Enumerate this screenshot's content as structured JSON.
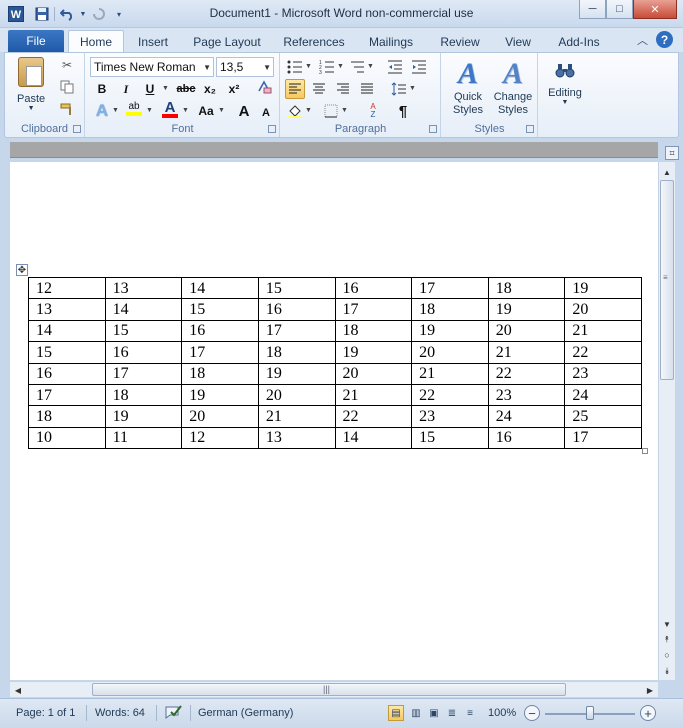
{
  "window": {
    "title": "Document1  -  Microsoft Word non-commercial use",
    "app_icon_letter": "W",
    "minimize": "─",
    "maximize": "□",
    "close": "✕"
  },
  "tabs": {
    "file": "File",
    "items": [
      "Home",
      "Insert",
      "Page Layout",
      "References",
      "Mailings",
      "Review",
      "View",
      "Add-Ins"
    ],
    "active": "Home"
  },
  "ribbon": {
    "clipboard": {
      "label": "Clipboard",
      "paste": "Paste"
    },
    "font": {
      "label": "Font",
      "font_name": "Times New Roman",
      "font_size": "13,5",
      "bold": "B",
      "italic": "I",
      "underline": "U",
      "strike": "abc",
      "subscript": "x₂",
      "superscript": "x²",
      "grow": "A",
      "shrink": "A",
      "case": "Aa",
      "color_a": "A",
      "highlight": "ab"
    },
    "paragraph": {
      "label": "Paragraph",
      "pilcrow": "¶"
    },
    "styles": {
      "label": "Styles",
      "quick_styles": "Quick Styles",
      "change_styles": "Change Styles",
      "glyph": "A"
    },
    "editing": {
      "label": "Editing"
    }
  },
  "accent_colors": {
    "file_tab": "#2b64b4",
    "highlight_yellow": "#ffff00",
    "font_red": "#ff0000"
  },
  "table": {
    "rows": [
      [
        "12",
        "13",
        "14",
        "15",
        "16",
        "17",
        "18",
        "19"
      ],
      [
        "13",
        "14",
        "15",
        "16",
        "17",
        "18",
        "19",
        "20"
      ],
      [
        "14",
        "15",
        "16",
        "17",
        "18",
        "19",
        "20",
        "21"
      ],
      [
        "15",
        "16",
        "17",
        "18",
        "19",
        "20",
        "21",
        "22"
      ],
      [
        "16",
        "17",
        "18",
        "19",
        "20",
        "21",
        "22",
        "23"
      ],
      [
        "17",
        "18",
        "19",
        "20",
        "21",
        "22",
        "23",
        "24"
      ],
      [
        "18",
        "19",
        "20",
        "21",
        "22",
        "23",
        "24",
        "25"
      ],
      [
        "10",
        "11",
        "12",
        "13",
        "14",
        "15",
        "16",
        "17"
      ]
    ]
  },
  "status": {
    "page": "Page: 1 of 1",
    "words": "Words: 64",
    "language": "German (Germany)",
    "zoom": "100%",
    "zoom_minus": "−",
    "zoom_plus": "+"
  }
}
